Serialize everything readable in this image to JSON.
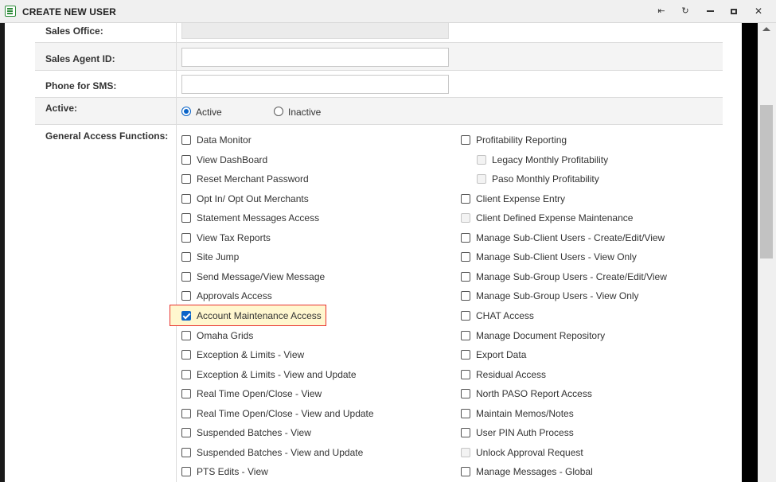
{
  "window": {
    "title": "CREATE NEW USER"
  },
  "form": {
    "sales_office": {
      "label": "Sales Office:",
      "value": ""
    },
    "sales_agent_id": {
      "label": "Sales Agent ID:",
      "value": ""
    },
    "phone_sms": {
      "label": "Phone for SMS:",
      "value": ""
    },
    "active": {
      "label": "Active:",
      "options": [
        "Active",
        "Inactive"
      ],
      "selected": "Active"
    },
    "general_access": {
      "label": "General Access Functions:",
      "left_column": [
        {
          "label": "Data Monitor",
          "checked": false
        },
        {
          "label": "View DashBoard",
          "checked": false
        },
        {
          "label": "Reset Merchant Password",
          "checked": false
        },
        {
          "label": "Opt In/ Opt Out Merchants",
          "checked": false
        },
        {
          "label": "Statement Messages Access",
          "checked": false
        },
        {
          "label": "View Tax Reports",
          "checked": false
        },
        {
          "label": "Site Jump",
          "checked": false
        },
        {
          "label": "Send Message/View Message",
          "checked": false
        },
        {
          "label": "Approvals Access",
          "checked": false
        },
        {
          "label": "Account Maintenance Access",
          "checked": true,
          "highlighted": true
        },
        {
          "label": "Omaha Grids",
          "checked": false
        },
        {
          "label": "Exception & Limits - View",
          "checked": false
        },
        {
          "label": "Exception & Limits - View and Update",
          "checked": false
        },
        {
          "label": "Real Time Open/Close - View",
          "checked": false
        },
        {
          "label": "Real Time Open/Close - View and Update",
          "checked": false
        },
        {
          "label": "Suspended Batches - View",
          "checked": false
        },
        {
          "label": "Suspended Batches - View and Update",
          "checked": false
        },
        {
          "label": "PTS Edits - View",
          "checked": false
        }
      ],
      "right_column": [
        {
          "label": "Profitability Reporting",
          "checked": false,
          "disabled": false,
          "indent": false
        },
        {
          "label": "Legacy Monthly Profitability",
          "checked": false,
          "disabled": true,
          "indent": true
        },
        {
          "label": "Paso Monthly Profitability",
          "checked": false,
          "disabled": true,
          "indent": true
        },
        {
          "label": "Client Expense Entry",
          "checked": false,
          "disabled": false,
          "indent": false
        },
        {
          "label": "Client Defined Expense Maintenance",
          "checked": false,
          "disabled": true,
          "indent": false
        },
        {
          "label": "Manage Sub-Client Users - Create/Edit/View",
          "checked": false,
          "disabled": false,
          "indent": false
        },
        {
          "label": "Manage Sub-Client Users - View Only",
          "checked": false,
          "disabled": false,
          "indent": false
        },
        {
          "label": "Manage Sub-Group Users - Create/Edit/View",
          "checked": false,
          "disabled": false,
          "indent": false
        },
        {
          "label": "Manage Sub-Group Users - View Only",
          "checked": false,
          "disabled": false,
          "indent": false
        },
        {
          "label": "CHAT Access",
          "checked": false,
          "disabled": false,
          "indent": false
        },
        {
          "label": "Manage Document Repository",
          "checked": false,
          "disabled": false,
          "indent": false
        },
        {
          "label": "Export Data",
          "checked": false,
          "disabled": false,
          "indent": false
        },
        {
          "label": "Residual Access",
          "checked": false,
          "disabled": false,
          "indent": false
        },
        {
          "label": "North PASO Report Access",
          "checked": false,
          "disabled": false,
          "indent": false
        },
        {
          "label": "Maintain Memos/Notes",
          "checked": false,
          "disabled": false,
          "indent": false
        },
        {
          "label": "User PIN Auth Process",
          "checked": false,
          "disabled": false,
          "indent": false
        },
        {
          "label": "Unlock Approval Request",
          "checked": false,
          "disabled": true,
          "indent": false
        },
        {
          "label": "Manage Messages - Global",
          "checked": false,
          "disabled": false,
          "indent": false
        }
      ]
    }
  },
  "colors": {
    "accent": "#0a64c8",
    "highlight_border": "#e8322e",
    "highlight_fill": "#fff7cf"
  },
  "icons": [
    "form-icon",
    "pin-icon",
    "refresh-icon",
    "minimize-icon",
    "maximize-icon",
    "close-icon"
  ]
}
